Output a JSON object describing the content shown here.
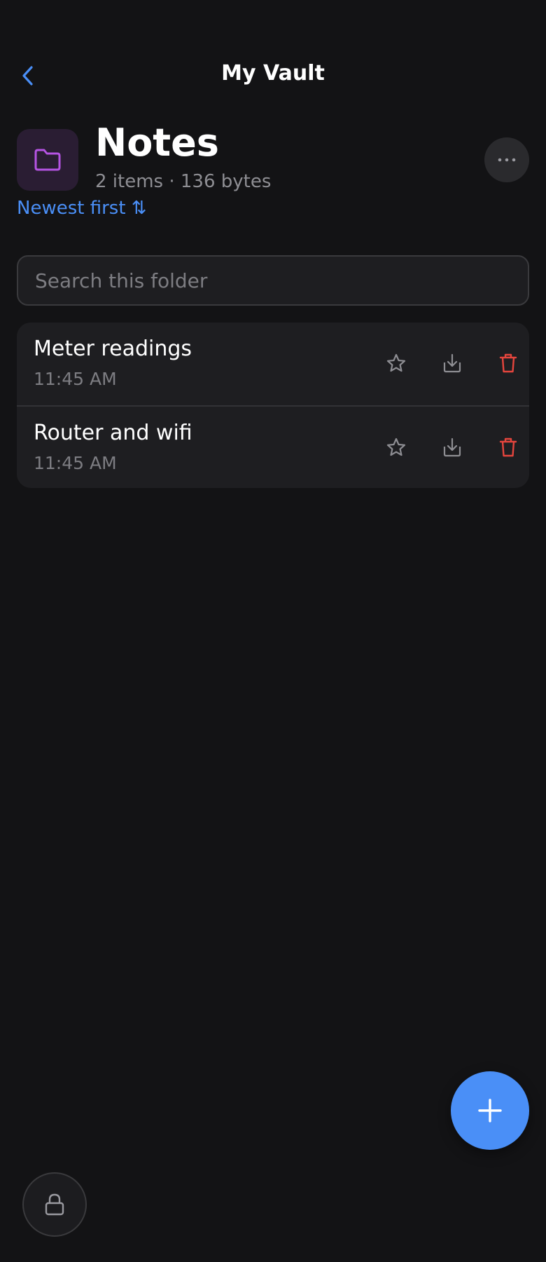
{
  "nav": {
    "title": "My Vault",
    "back_icon": "chevron-left-icon"
  },
  "folder": {
    "icon": "folder-icon",
    "title": "Notes",
    "meta": "2 items · 136 bytes",
    "more_icon": "ellipsis-icon",
    "sort_label": "Newest first ⇅"
  },
  "search": {
    "placeholder": "Search this folder",
    "value": ""
  },
  "items": [
    {
      "title": "Meter readings",
      "time": "11:45 AM"
    },
    {
      "title": "Router and wifi",
      "time": "11:45 AM"
    }
  ],
  "row_actions": [
    "star-icon",
    "download-icon",
    "trash-icon"
  ],
  "fab_icon": "plus-icon",
  "lock_icon": "lock-icon",
  "colors": {
    "background": "#131315",
    "card": "#1e1e21",
    "accent": "#4a8ff7",
    "folder_accent": "#b554e3",
    "danger": "#e5453d",
    "muted": "#8e8e93"
  }
}
